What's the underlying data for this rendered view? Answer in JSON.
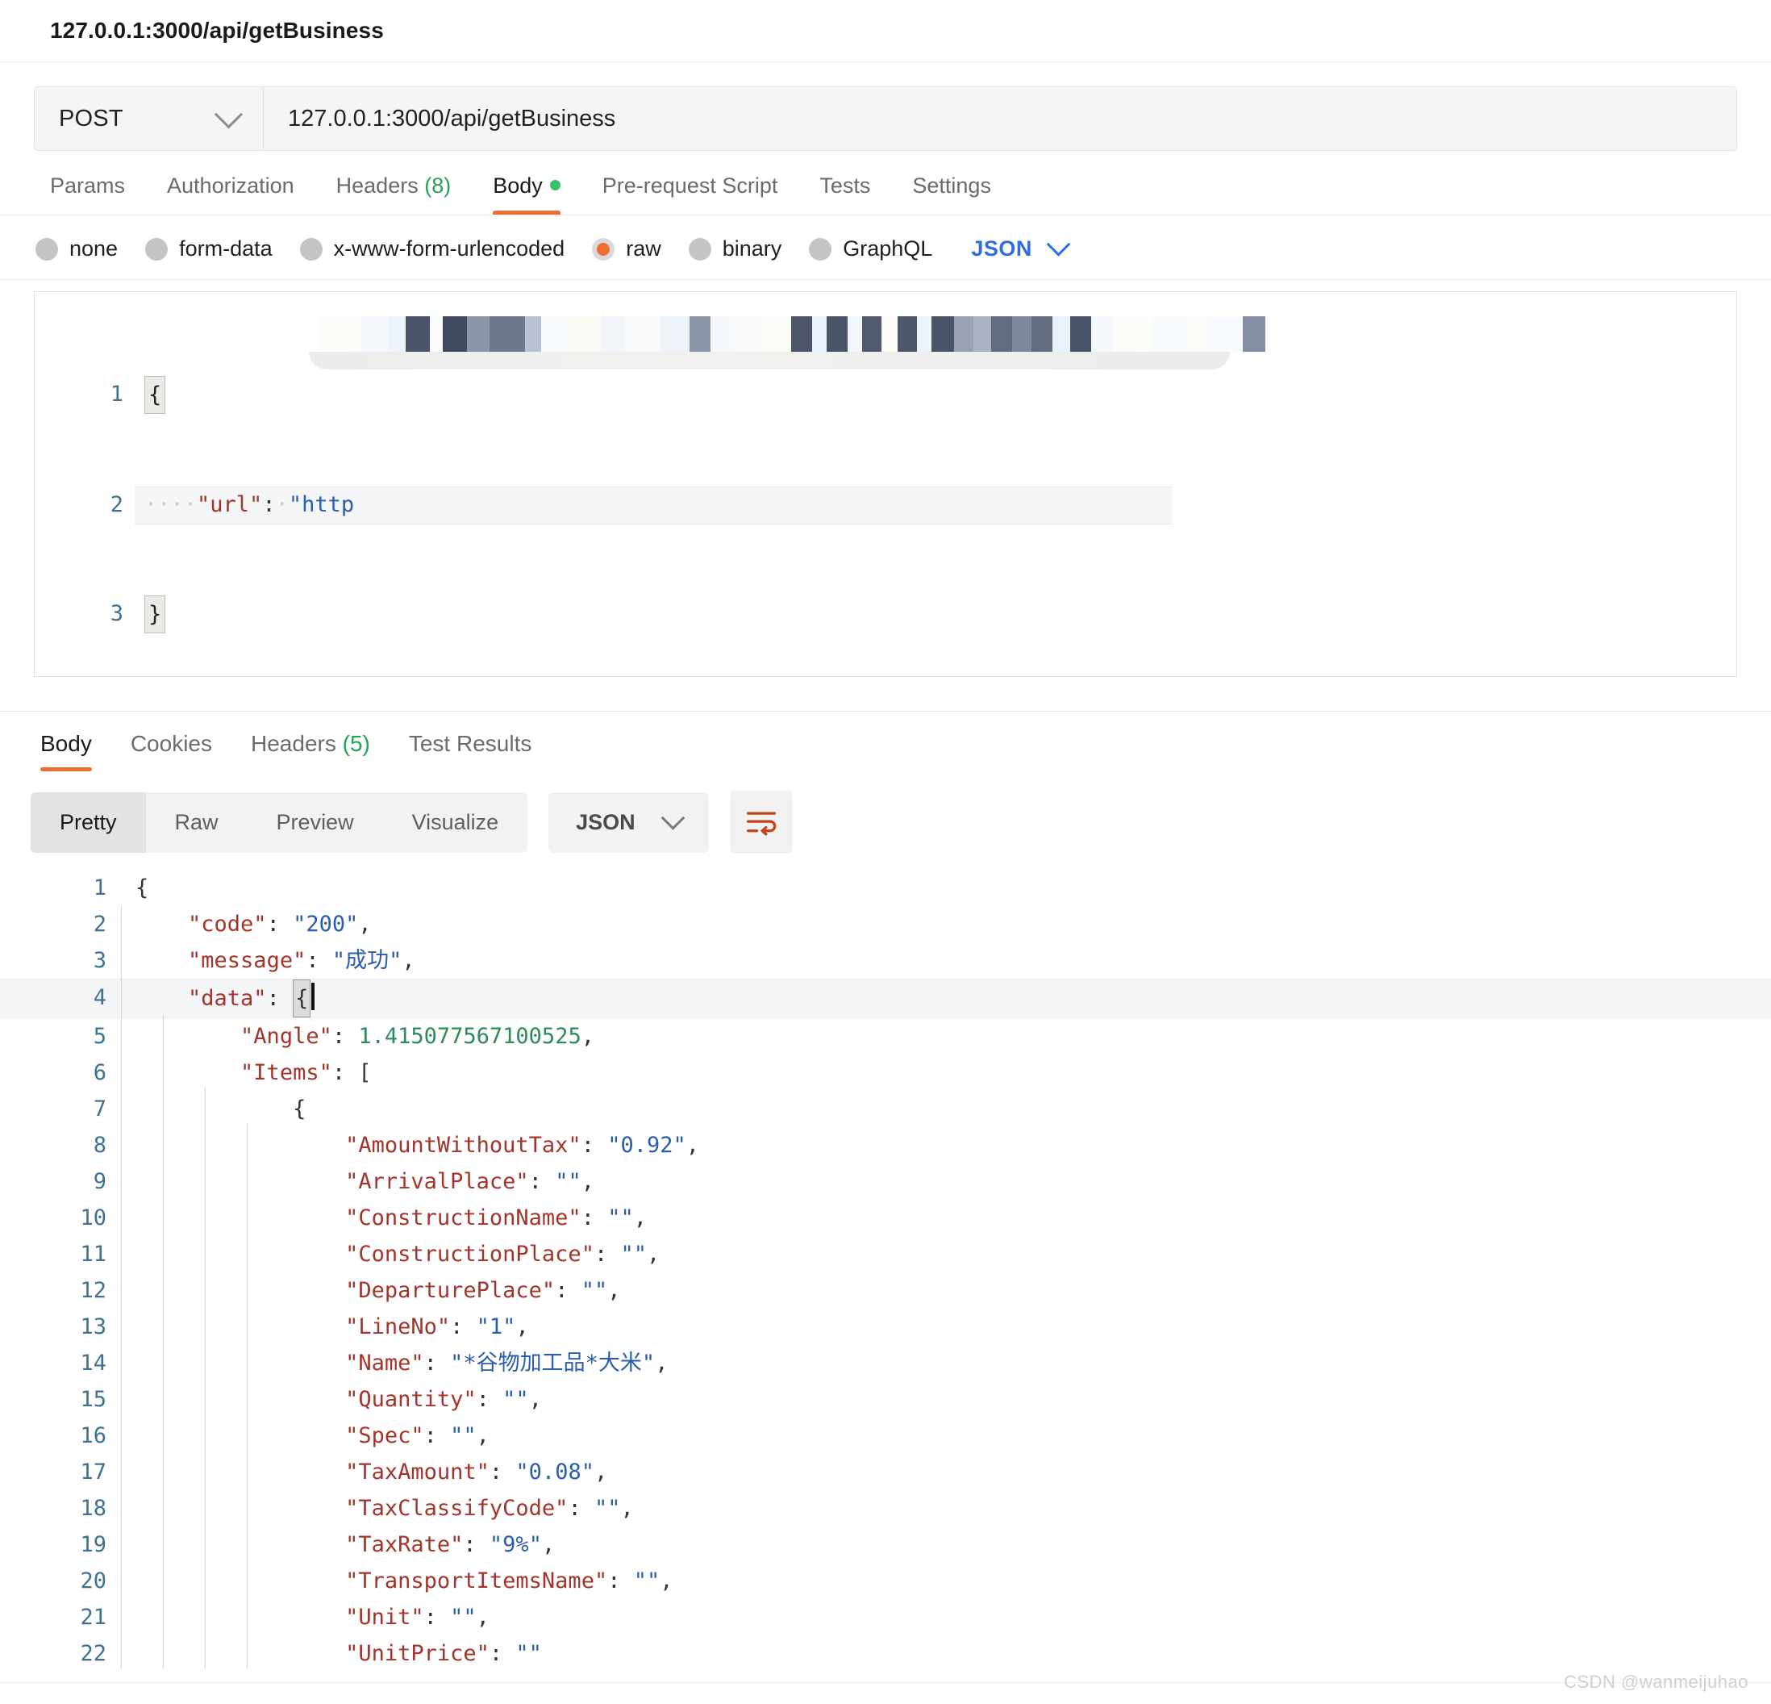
{
  "request": {
    "title": "127.0.0.1:3000/api/getBusiness",
    "method": "POST",
    "url": "127.0.0.1:3000/api/getBusiness",
    "tabs": [
      {
        "label": "Params",
        "active": false
      },
      {
        "label": "Authorization",
        "active": false
      },
      {
        "label": "Headers",
        "count": "(8)",
        "active": false
      },
      {
        "label": "Body",
        "active": true,
        "dot": true
      },
      {
        "label": "Pre-request Script",
        "active": false
      },
      {
        "label": "Tests",
        "active": false
      },
      {
        "label": "Settings",
        "active": false
      }
    ],
    "body_types": [
      {
        "label": "none",
        "selected": false
      },
      {
        "label": "form-data",
        "selected": false
      },
      {
        "label": "x-www-form-urlencoded",
        "selected": false
      },
      {
        "label": "raw",
        "selected": true
      },
      {
        "label": "binary",
        "selected": false
      },
      {
        "label": "GraphQL",
        "selected": false
      }
    ],
    "language": "JSON",
    "editor": {
      "lines": [
        "1",
        "2",
        "3"
      ],
      "line1": "{",
      "line2_indent": "····",
      "line2_key": "\"url\"",
      "line2_colon": ":",
      "line2_space": "·",
      "line2_value": "\"http",
      "line3": "}",
      "redacted_note": "mosaic-redacted-url"
    }
  },
  "response": {
    "tabs": [
      {
        "label": "Body",
        "active": true
      },
      {
        "label": "Cookies",
        "active": false
      },
      {
        "label": "Headers",
        "count": "(5)",
        "active": false
      },
      {
        "label": "Test Results",
        "active": false
      }
    ],
    "view_modes": [
      {
        "label": "Pretty",
        "active": true
      },
      {
        "label": "Raw",
        "active": false
      },
      {
        "label": "Preview",
        "active": false
      },
      {
        "label": "Visualize",
        "active": false
      }
    ],
    "format": "JSON",
    "wrap_icon": "word-wrap-icon",
    "wrap_icon_color": "#c1441b",
    "body_lines": [
      {
        "no": "1",
        "indent": 0,
        "text": "{"
      },
      {
        "no": "2",
        "indent": 1,
        "key": "\"code\"",
        "value": "\"200\"",
        "vtype": "string",
        "comma": ","
      },
      {
        "no": "3",
        "indent": 1,
        "key": "\"message\"",
        "value": "\"成功\"",
        "vtype": "string",
        "comma": ","
      },
      {
        "no": "4",
        "indent": 1,
        "key": "\"data\"",
        "value": "{",
        "vtype": "brace",
        "comma": "",
        "highlight": true
      },
      {
        "no": "5",
        "indent": 2,
        "key": "\"Angle\"",
        "value": "1.415077567100525",
        "vtype": "number",
        "comma": ","
      },
      {
        "no": "6",
        "indent": 2,
        "key": "\"Items\"",
        "value": "[",
        "vtype": "brace",
        "comma": ""
      },
      {
        "no": "7",
        "indent": 3,
        "text": "{"
      },
      {
        "no": "8",
        "indent": 4,
        "key": "\"AmountWithoutTax\"",
        "value": "\"0.92\"",
        "vtype": "string",
        "comma": ","
      },
      {
        "no": "9",
        "indent": 4,
        "key": "\"ArrivalPlace\"",
        "value": "\"\"",
        "vtype": "string",
        "comma": ","
      },
      {
        "no": "10",
        "indent": 4,
        "key": "\"ConstructionName\"",
        "value": "\"\"",
        "vtype": "string",
        "comma": ","
      },
      {
        "no": "11",
        "indent": 4,
        "key": "\"ConstructionPlace\"",
        "value": "\"\"",
        "vtype": "string",
        "comma": ","
      },
      {
        "no": "12",
        "indent": 4,
        "key": "\"DeparturePlace\"",
        "value": "\"\"",
        "vtype": "string",
        "comma": ","
      },
      {
        "no": "13",
        "indent": 4,
        "key": "\"LineNo\"",
        "value": "\"1\"",
        "vtype": "string",
        "comma": ","
      },
      {
        "no": "14",
        "indent": 4,
        "key": "\"Name\"",
        "value": "\"*谷物加工品*大米\"",
        "vtype": "string",
        "comma": ","
      },
      {
        "no": "15",
        "indent": 4,
        "key": "\"Quantity\"",
        "value": "\"\"",
        "vtype": "string",
        "comma": ","
      },
      {
        "no": "16",
        "indent": 4,
        "key": "\"Spec\"",
        "value": "\"\"",
        "vtype": "string",
        "comma": ","
      },
      {
        "no": "17",
        "indent": 4,
        "key": "\"TaxAmount\"",
        "value": "\"0.08\"",
        "vtype": "string",
        "comma": ","
      },
      {
        "no": "18",
        "indent": 4,
        "key": "\"TaxClassifyCode\"",
        "value": "\"\"",
        "vtype": "string",
        "comma": ","
      },
      {
        "no": "19",
        "indent": 4,
        "key": "\"TaxRate\"",
        "value": "\"9%\"",
        "vtype": "string",
        "comma": ","
      },
      {
        "no": "20",
        "indent": 4,
        "key": "\"TransportItemsName\"",
        "value": "\"\"",
        "vtype": "string",
        "comma": ","
      },
      {
        "no": "21",
        "indent": 4,
        "key": "\"Unit\"",
        "value": "\"\"",
        "vtype": "string",
        "comma": ","
      },
      {
        "no": "22",
        "indent": 4,
        "key": "\"UnitPrice\"",
        "value": "\"\"",
        "vtype": "string",
        "comma": ""
      }
    ]
  },
  "watermark": "CSDN @wanmeijuhao",
  "colors": {
    "accent": "#ef6c33",
    "json_key": "#a4342b",
    "json_string": "#2a5db0",
    "json_number": "#2e8b57",
    "link_blue": "#2f6ee0",
    "green_count": "#23a455",
    "gutter": "#3d7390"
  }
}
